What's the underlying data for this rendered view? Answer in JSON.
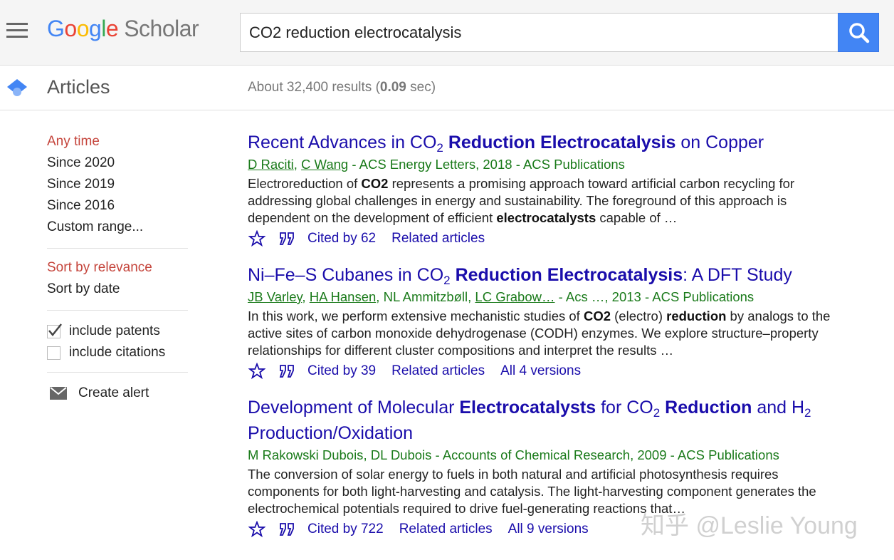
{
  "header": {
    "logo": {
      "google": [
        "G",
        "o",
        "o",
        "g",
        "l",
        "e"
      ],
      "scholar": "Scholar"
    },
    "search": {
      "value": "CO2 reduction electrocatalysis"
    },
    "colors": {
      "accent": "#4285f4",
      "link": "#1a0dab",
      "green": "#1a7a1a",
      "active": "#c5453c"
    }
  },
  "subheader": {
    "title": "Articles",
    "stats_prefix": "About 32,400 results (",
    "stats_time": "0.09",
    "stats_suffix": " sec)"
  },
  "sidebar": {
    "time_filters": [
      "Any time",
      "Since 2020",
      "Since 2019",
      "Since 2016",
      "Custom range..."
    ],
    "sort_options": [
      "Sort by relevance",
      "Sort by date"
    ],
    "checkboxes": [
      {
        "label": "include patents",
        "checked": true
      },
      {
        "label": "include citations",
        "checked": false
      }
    ],
    "alert_label": "Create alert"
  },
  "results": [
    {
      "title_html_parts": [
        "Recent Advances in CO",
        "2",
        " ",
        "Reduction Electrocatalysis",
        " on Copper"
      ],
      "authors": [
        "D Raciti",
        "C Wang"
      ],
      "source": " - ACS Energy Letters, 2018 - ACS Publications",
      "snippet_parts": [
        "Electroreduction of ",
        "CO2",
        " represents a promising approach toward artificial carbon recycling for addressing global challenges in energy and sustainability. The foreground of this approach is dependent on the development of efficient ",
        "electrocatalysts",
        " capable of …"
      ],
      "cited_by": "Cited by 62",
      "related": "Related articles",
      "versions": ""
    },
    {
      "title_html_parts": [
        "Ni–Fe–S Cubanes in CO",
        "2",
        " ",
        "Reduction Electrocatalysis",
        ": A DFT Study"
      ],
      "authors": [
        "JB Varley",
        "HA Hansen",
        "NL Ammitzbøll",
        "LC Grabow…"
      ],
      "source": " - Acs …, 2013 - ACS Publications",
      "snippet_parts": [
        "In this work, we perform extensive mechanistic studies of ",
        "CO2",
        " (electro) ",
        "reduction",
        " by analogs to the active sites of carbon monoxide dehydrogenase (CODH) enzymes. We explore structure–property relationships for different cluster compositions and interpret the results …"
      ],
      "cited_by": "Cited by 39",
      "related": "Related articles",
      "versions": "All 4 versions"
    },
    {
      "title_html_parts": [
        "Development of Molecular ",
        "Electrocatalysts",
        " for CO",
        "2",
        " ",
        "Reduction",
        " and H",
        "2",
        " Production/Oxidation"
      ],
      "authors": [
        "M Rakowski Dubois",
        "DL Dubois"
      ],
      "source": " - Accounts of Chemical Research, 2009 - ACS Publications",
      "snippet_parts": [
        "The conversion of solar energy to fuels in both natural and artificial photosynthesis requires components for both light-harvesting and catalysis. The light-harvesting component generates the electrochemical potentials required to drive fuel-generating reactions that…"
      ],
      "cited_by": "Cited by 722",
      "related": "Related articles",
      "versions": "All 9 versions"
    }
  ],
  "watermark": "知乎 @Leslie Young"
}
